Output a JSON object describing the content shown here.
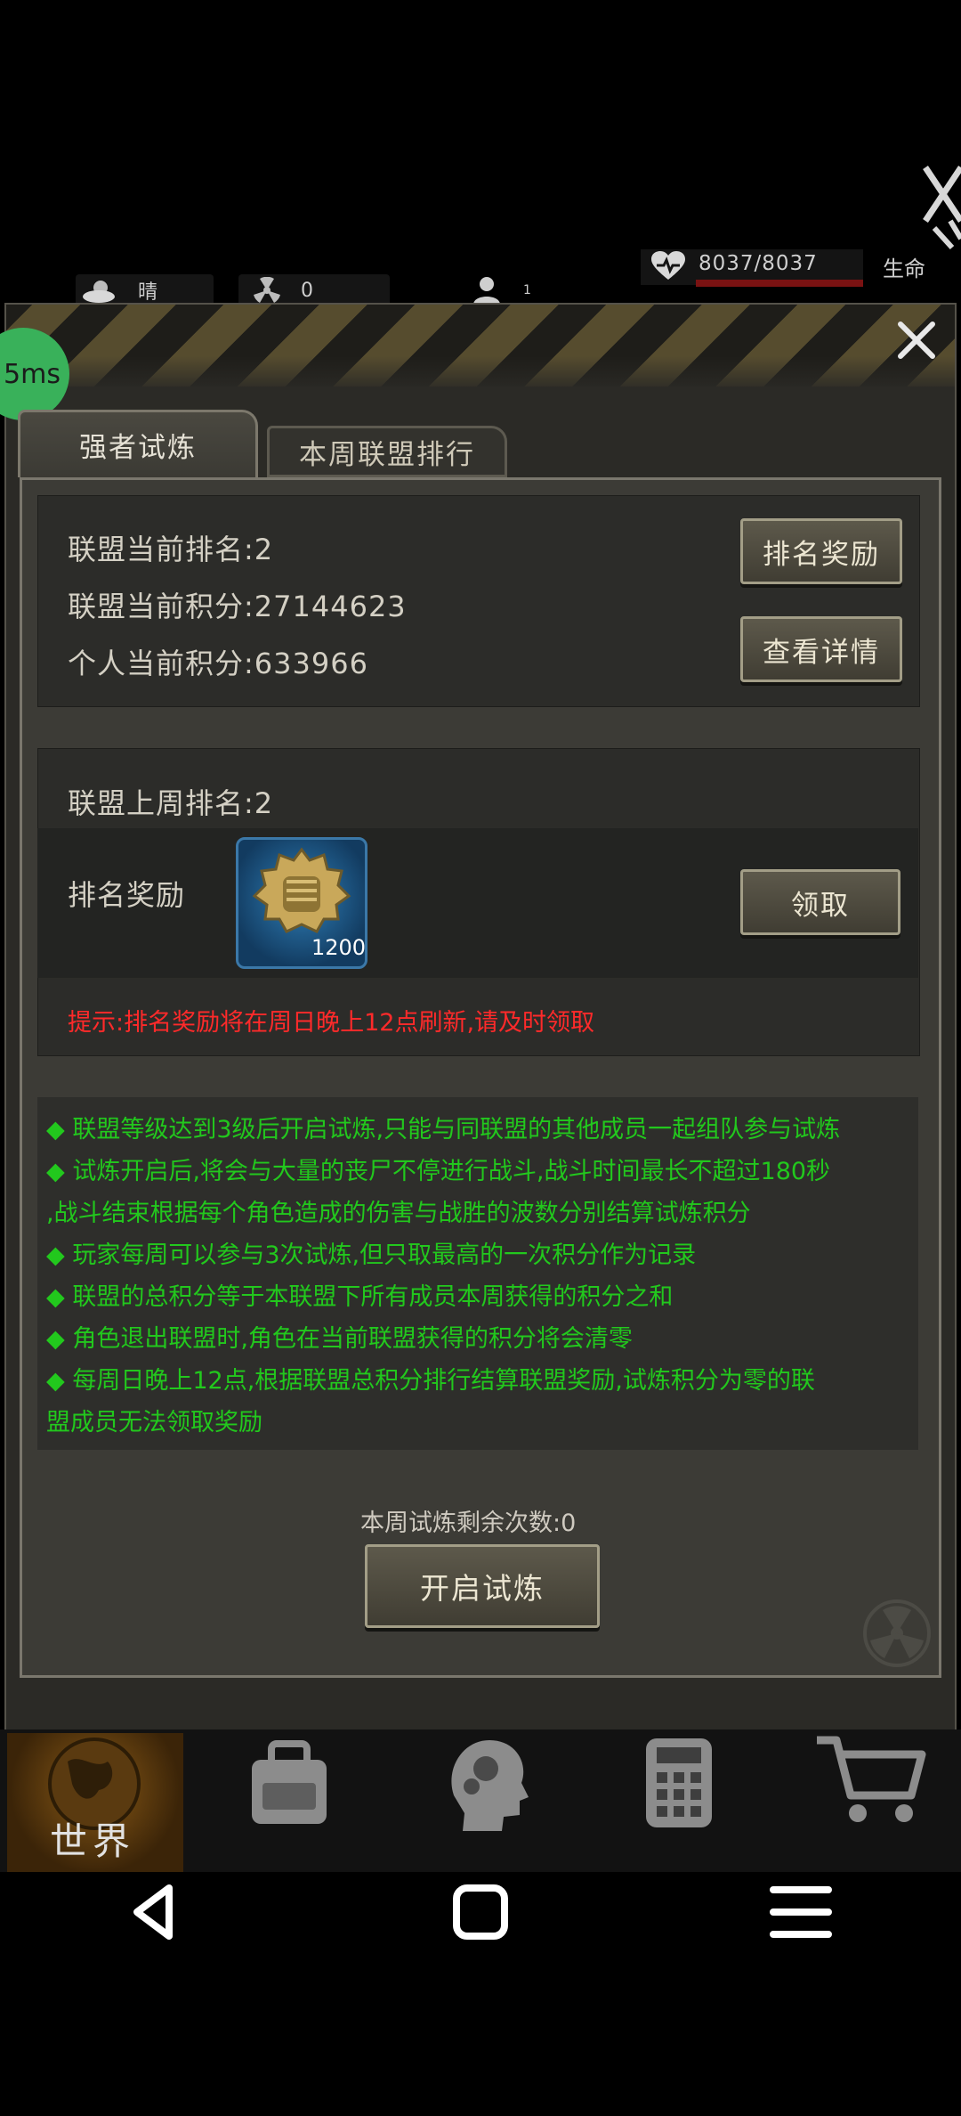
{
  "status_bar": {
    "weather": "晴",
    "radiation": "0",
    "players": "1",
    "hp": "8037/8037",
    "life_label": "生命"
  },
  "ping": "5ms",
  "tabs": [
    {
      "label": "强者试炼",
      "active": true
    },
    {
      "label": "本周联盟排行",
      "active": false
    }
  ],
  "current": {
    "rank": "联盟当前排名:2",
    "alliance_score": "联盟当前积分:27144623",
    "personal_score": "个人当前积分:633966",
    "rank_reward_button": "排名奖励",
    "details_button": "查看详情"
  },
  "last_week": {
    "rank": "联盟上周排名:2",
    "reward_label": "排名奖励",
    "reward_count": "1200",
    "claim_button": "领取",
    "tip": "提示:排名奖励将在周日晚上12点刷新,请及时领取"
  },
  "rules": [
    "◆ 联盟等级达到3级后开启试炼,只能与同联盟的其他成员一起组队参与试炼",
    "◆ 试炼开启后,将会与大量的丧尸不停进行战斗,战斗时间最长不超过180秒",
    ",战斗结束根据每个角色造成的伤害与战胜的波数分别结算试炼积分",
    "◆  玩家每周可以参与3次试炼,但只取最高的一次积分作为记录",
    "◆  联盟的总积分等于本联盟下所有成员本周获得的积分之和",
    "◆  角色退出联盟时,角色在当前联盟获得的积分将会清零",
    "◆  每周日晚上12点,根据联盟总积分排行结算联盟奖励,试炼积分为零的联",
    "盟成员无法领取奖励"
  ],
  "remaining": "本周试炼剩余次数:0",
  "start_button": "开启试炼",
  "bottom_nav": {
    "world_label": "世界"
  },
  "colors": {
    "rule_green": "#22c81d",
    "tip_red": "#ff2a2a",
    "panel": "#3c3b36"
  }
}
